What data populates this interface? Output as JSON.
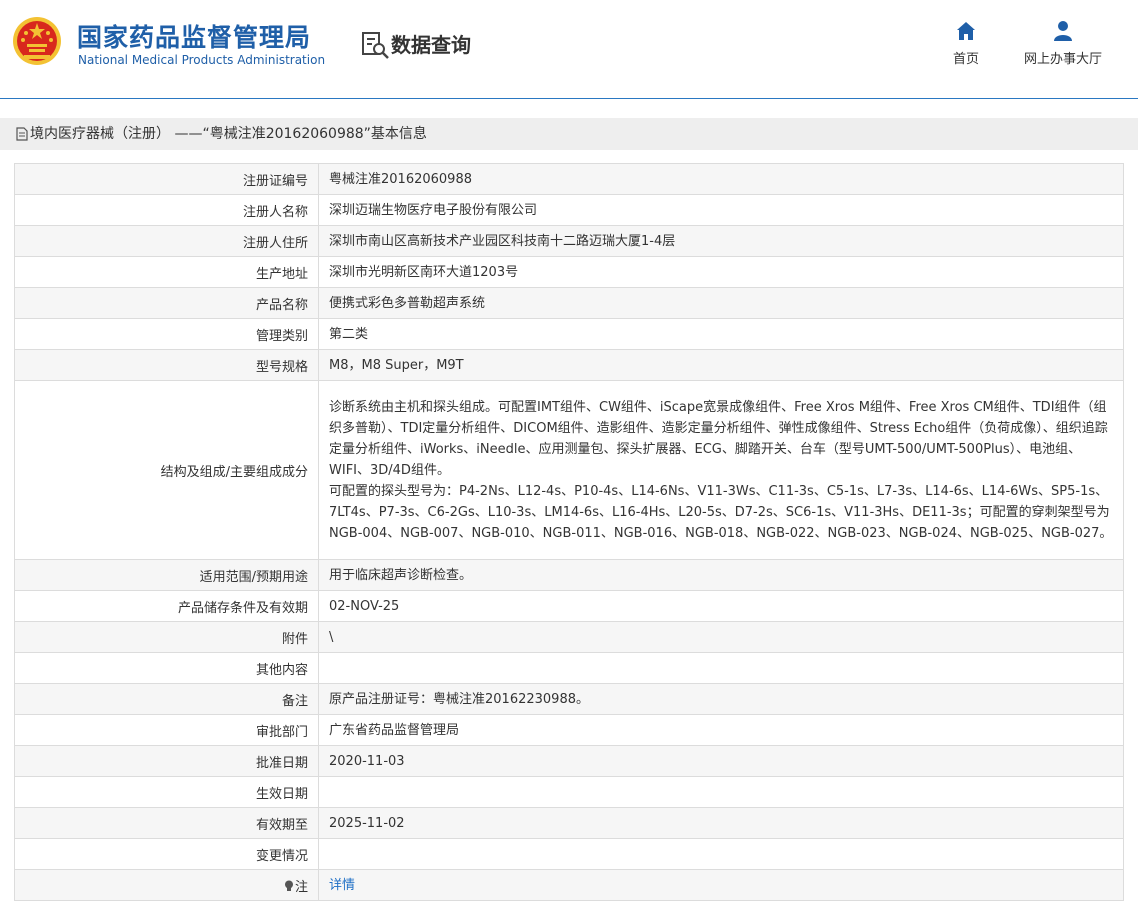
{
  "header": {
    "brand_cn": "国家药品监督管理局",
    "brand_en": "National Medical Products Administration",
    "query_label": "数据查询",
    "nav": [
      {
        "label": "首页",
        "icon": "home-icon"
      },
      {
        "label": "网上办事大厅",
        "icon": "user-icon"
      }
    ]
  },
  "section_title": "境内医疗器械（注册） ——“粤械注准20162060988”基本信息",
  "rows": [
    {
      "label": "注册证编号",
      "value": "粤械注准20162060988"
    },
    {
      "label": "注册人名称",
      "value": "深圳迈瑞生物医疗电子股份有限公司"
    },
    {
      "label": "注册人住所",
      "value": "深圳市南山区高新技术产业园区科技南十二路迈瑞大厦1-4层"
    },
    {
      "label": "生产地址",
      "value": "深圳市光明新区南环大道1203号"
    },
    {
      "label": "产品名称",
      "value": "便携式彩色多普勒超声系统"
    },
    {
      "label": "管理类别",
      "value": "第二类"
    },
    {
      "label": "型号规格",
      "value": "M8，M8 Super，M9T"
    },
    {
      "label": "结构及组成/主要组成成分",
      "value_line1": "诊断系统由主机和探头组成。可配置IMT组件、CW组件、iScape宽景成像组件、Free Xros M组件、Free Xros CM组件、TDI组件（组织多普勒）、TDI定量分析组件、DICOM组件、造影组件、造影定量分析组件、弹性成像组件、Stress Echo组件（负荷成像）、组织追踪定量分析组件、iWorks、iNeedle、应用测量包、探头扩展器、ECG、脚踏开关、台车（型号UMT-500/UMT-500Plus）、电池组、WIFI、3D/4D组件。",
      "value_line2": "可配置的探头型号为：P4-2Ns、L12-4s、P10-4s、L14-6Ns、V11-3Ws、C11-3s、C5-1s、L7-3s、L14-6s、L14-6Ws、SP5-1s、7LT4s、P7-3s、C6-2Gs、L10-3s、LM14-6s、L16-4Hs、L20-5s、D7-2s、SC6-1s、V11-3Hs、DE11-3s；可配置的穿刺架型号为NGB-004、NGB-007、NGB-010、NGB-011、NGB-016、NGB-018、NGB-022、NGB-023、NGB-024、NGB-025、NGB-027。"
    },
    {
      "label": "适用范围/预期用途",
      "value": "用于临床超声诊断检查。"
    },
    {
      "label": "产品储存条件及有效期",
      "value": "02-NOV-25"
    },
    {
      "label": "附件",
      "value": "\\"
    },
    {
      "label": "其他内容",
      "value": ""
    },
    {
      "label": "备注",
      "value": "原产品注册证号：粤械注准20162230988。"
    },
    {
      "label": "审批部门",
      "value": "广东省药品监督管理局"
    },
    {
      "label": "批准日期",
      "value": "2020-11-03"
    },
    {
      "label": "生效日期",
      "value": ""
    },
    {
      "label": "有效期至",
      "value": "2025-11-02"
    },
    {
      "label": "变更情况",
      "value": ""
    },
    {
      "label": "注",
      "value": "详情",
      "icon": "lightbulb-icon"
    }
  ],
  "colors": {
    "brand_blue": "#1f5fa8",
    "link_blue": "#1f6fc5",
    "emblem_red": "#d8281d",
    "emblem_gold": "#f3c233"
  }
}
